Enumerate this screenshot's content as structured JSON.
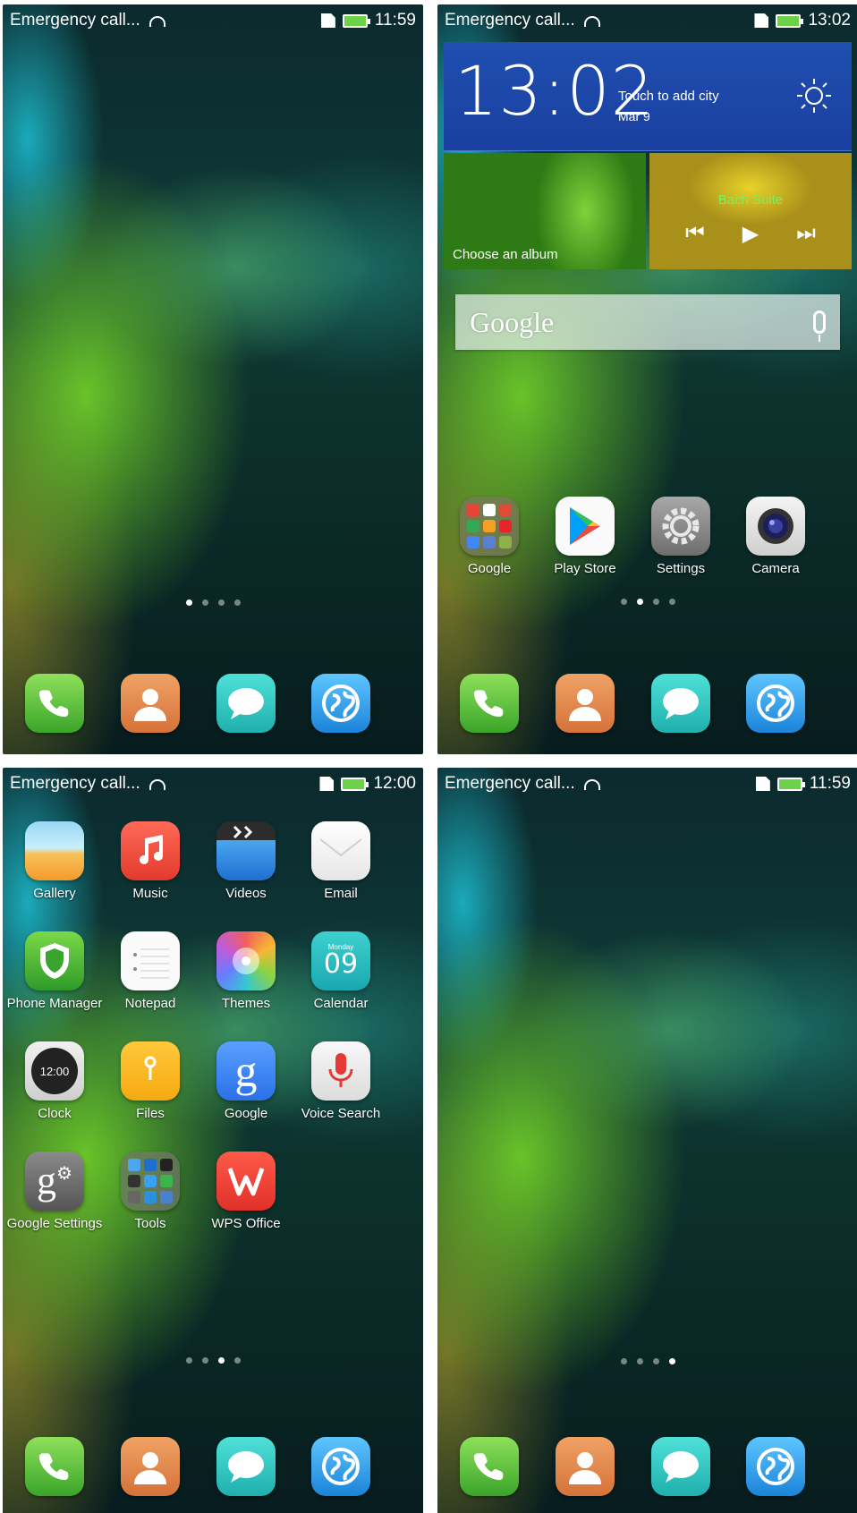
{
  "screens": [
    {
      "status_text": "Emergency call...",
      "time": "11:59"
    },
    {
      "status_text": "Emergency call...",
      "time": "13:02"
    },
    {
      "status_text": "Emergency call...",
      "time": "12:00"
    },
    {
      "status_text": "Emergency call...",
      "time": "11:59"
    }
  ],
  "dock": {
    "phone": "Phone",
    "contacts": "Contacts",
    "messages": "Messages",
    "browser": "Browser"
  },
  "weather_widget": {
    "time": "13:02",
    "city_prompt": "Touch to add city",
    "date": "Mar 9"
  },
  "photo_widget": {
    "label": "Choose an album"
  },
  "music_widget": {
    "title": "Bach Suite"
  },
  "search": {
    "logo": "Google"
  },
  "home2_apps": {
    "google_folder": "Google",
    "play_store": "Play Store",
    "settings": "Settings",
    "camera": "Camera"
  },
  "home3_apps": {
    "gallery": "Gallery",
    "music": "Music",
    "videos": "Videos",
    "email": "Email",
    "phone_manager": "Phone Manager",
    "notepad": "Notepad",
    "themes": "Themes",
    "calendar": "Calendar",
    "clock": "Clock",
    "files": "Files",
    "google": "Google",
    "voice_search": "Voice Search",
    "google_settings": "Google Settings",
    "tools": "Tools",
    "wps_office": "WPS Office"
  },
  "calendar_icon": {
    "weekday": "Monday",
    "day": "09"
  },
  "clock_icon": {
    "time": "12:00"
  },
  "page_indicator": {
    "screen1_active": 1,
    "screen2_active": 2,
    "screen3_active": 3,
    "screen4_active": 4,
    "total": 4
  }
}
